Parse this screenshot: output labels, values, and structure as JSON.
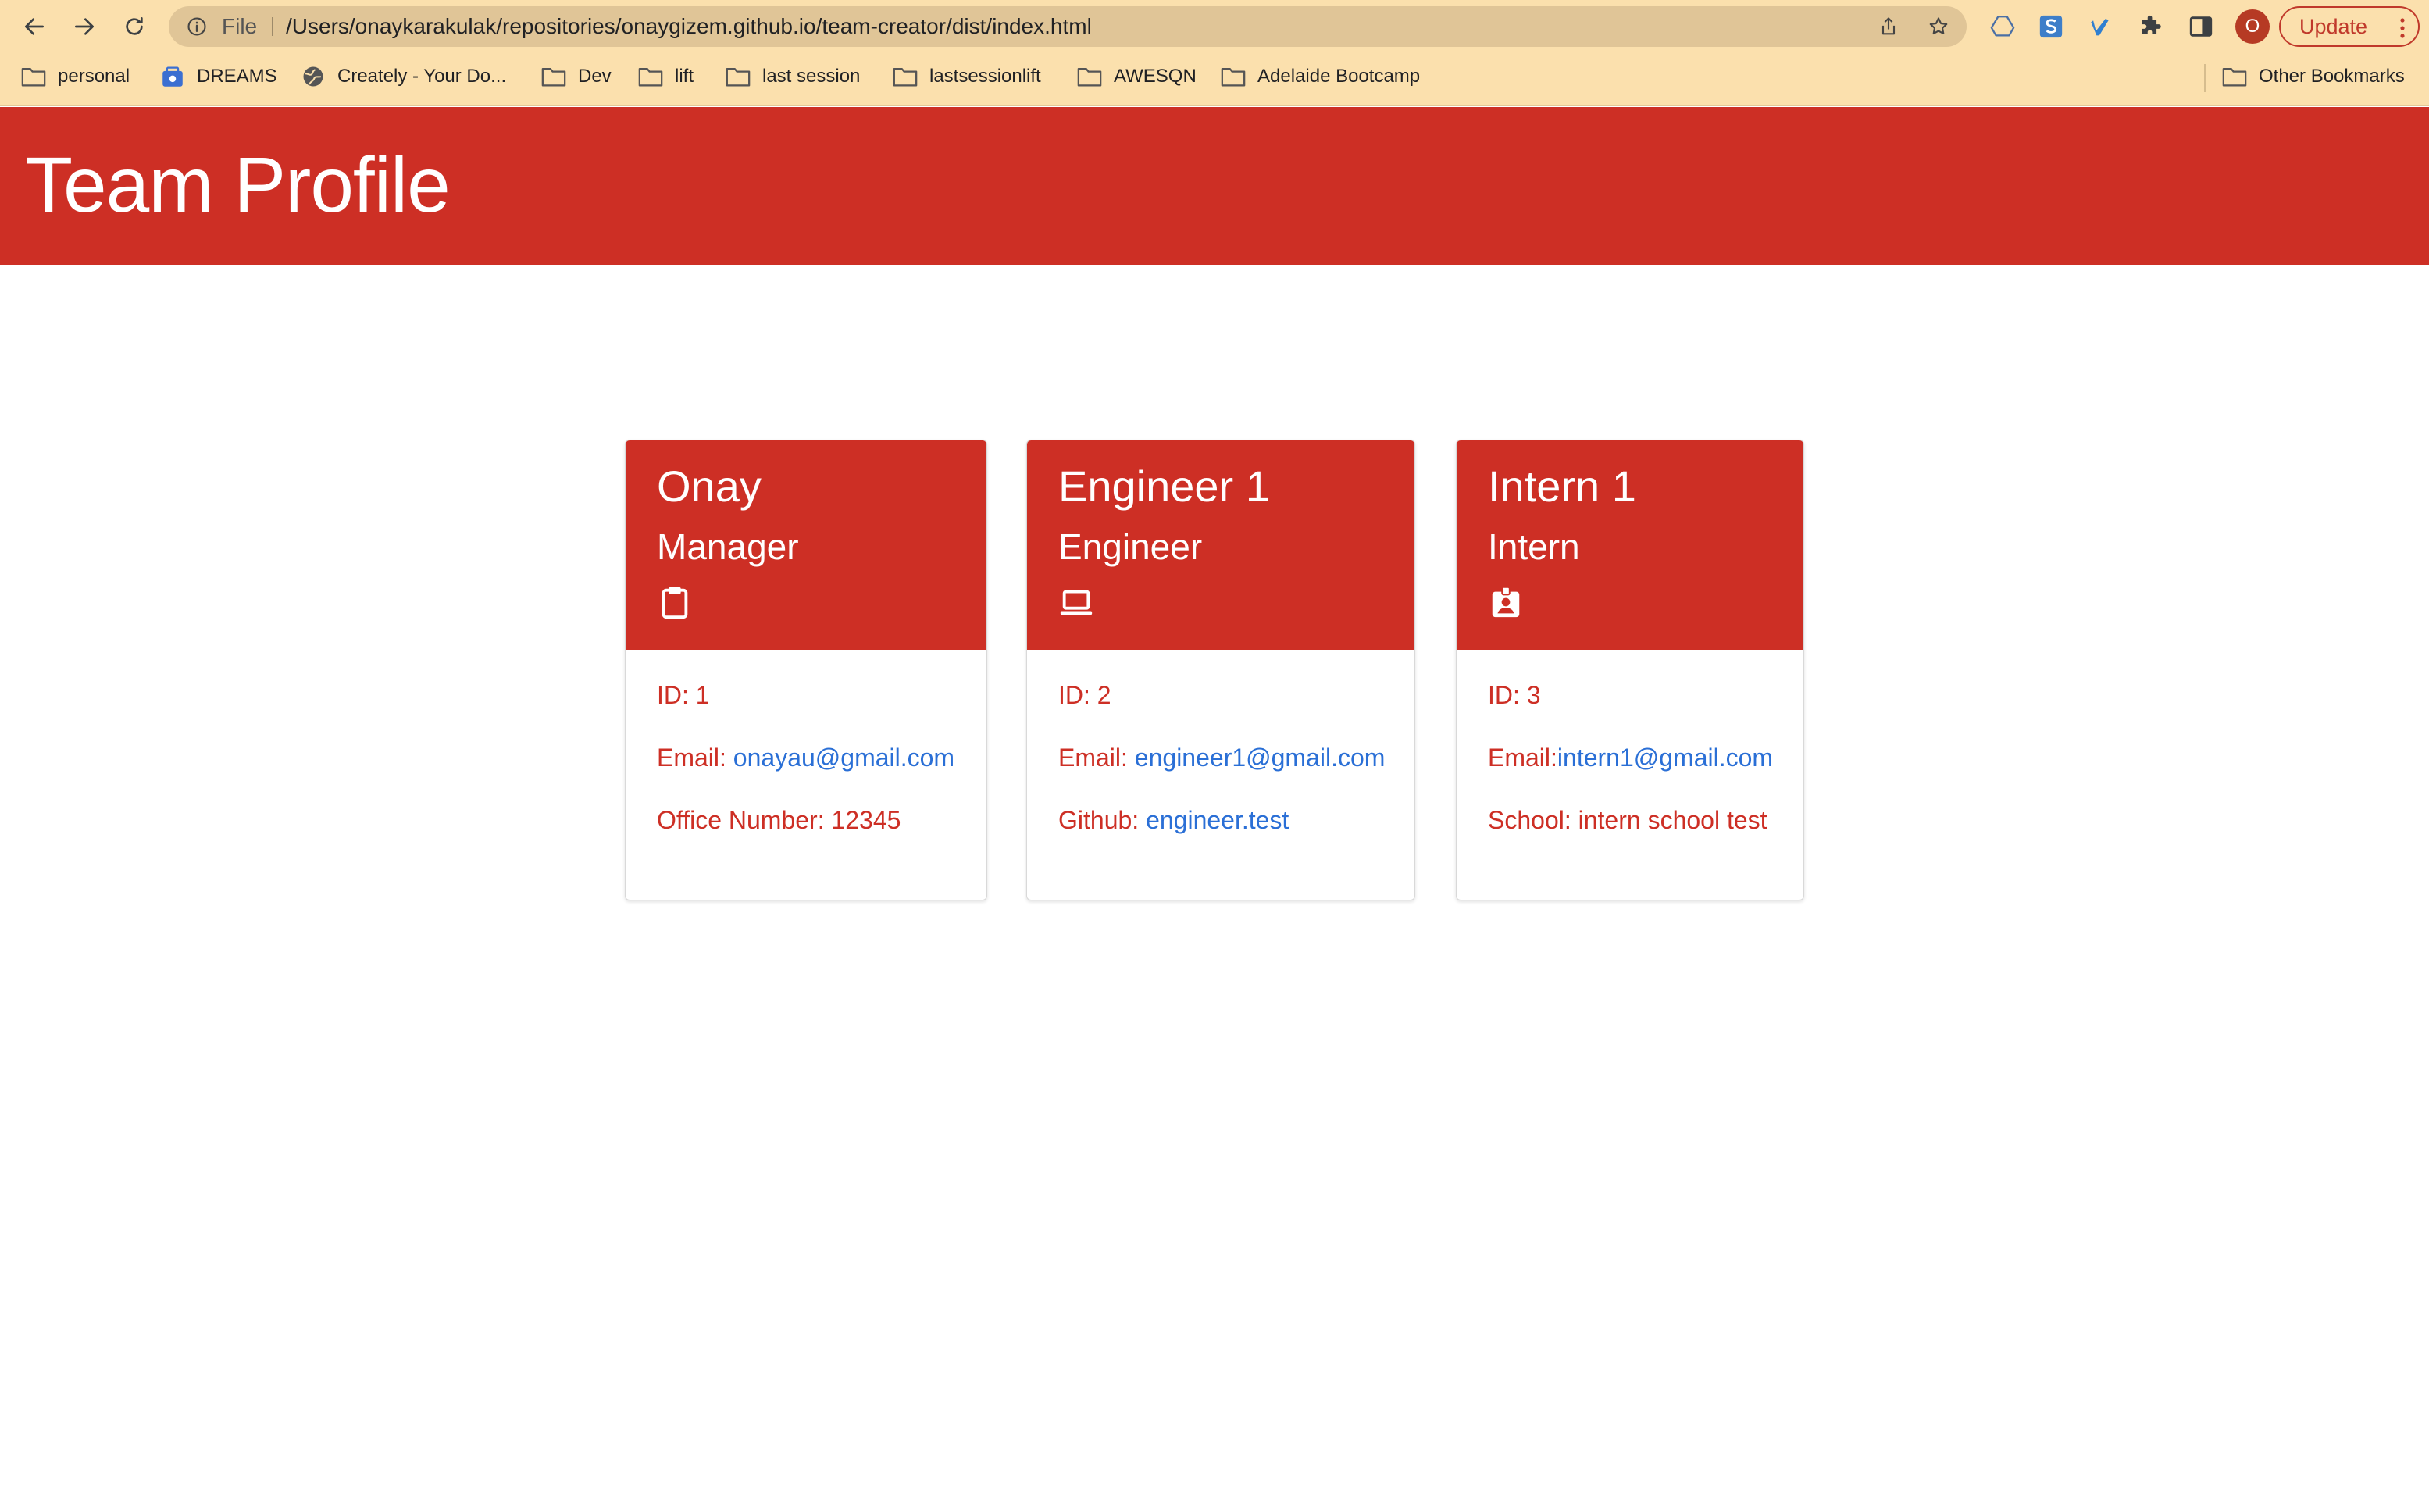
{
  "browser": {
    "scheme_label": "File",
    "url": "/Users/onaykarakulak/repositories/onaygizem.github.io/team-creator/dist/index.html",
    "profile_initial": "O",
    "update_label": "Update",
    "bookmarks": [
      {
        "label": "personal",
        "icon": "folder-icon"
      },
      {
        "label": "DREAMS",
        "icon": "dreams-icon"
      },
      {
        "label": "Creately - Your Do...",
        "icon": "globe-icon"
      },
      {
        "label": "Dev",
        "icon": "folder-icon"
      },
      {
        "label": "lift",
        "icon": "folder-icon"
      },
      {
        "label": "last session",
        "icon": "folder-icon"
      },
      {
        "label": "lastsessionlift",
        "icon": "folder-icon"
      },
      {
        "label": "AWESQN",
        "icon": "folder-icon"
      },
      {
        "label": "Adelaide Bootcamp",
        "icon": "folder-icon"
      }
    ],
    "other_bookmarks": "Other Bookmarks"
  },
  "page": {
    "title": "Team Profile",
    "accent_color": "#cd2f25",
    "link_color": "#2a6fd6"
  },
  "cards": [
    {
      "name": "Onay",
      "role": "Manager",
      "icon": "clipboard-icon",
      "id_line": "ID: 1",
      "email_label": "Email: ",
      "email": "onayau@gmail.com",
      "extra_label": "Office Number: 12345",
      "extra_link": ""
    },
    {
      "name": "Engineer 1",
      "role": "Engineer",
      "icon": "laptop-icon",
      "id_line": "ID: 2",
      "email_label": "Email: ",
      "email": "engineer1@gmail.com",
      "extra_label": "Github: ",
      "extra_link": "engineer.test"
    },
    {
      "name": "Intern 1",
      "role": "Intern",
      "icon": "id-badge-icon",
      "id_line": "ID: 3",
      "email_label": "Email:",
      "email": "intern1@gmail.com",
      "extra_label": "School: intern school test",
      "extra_link": ""
    }
  ]
}
